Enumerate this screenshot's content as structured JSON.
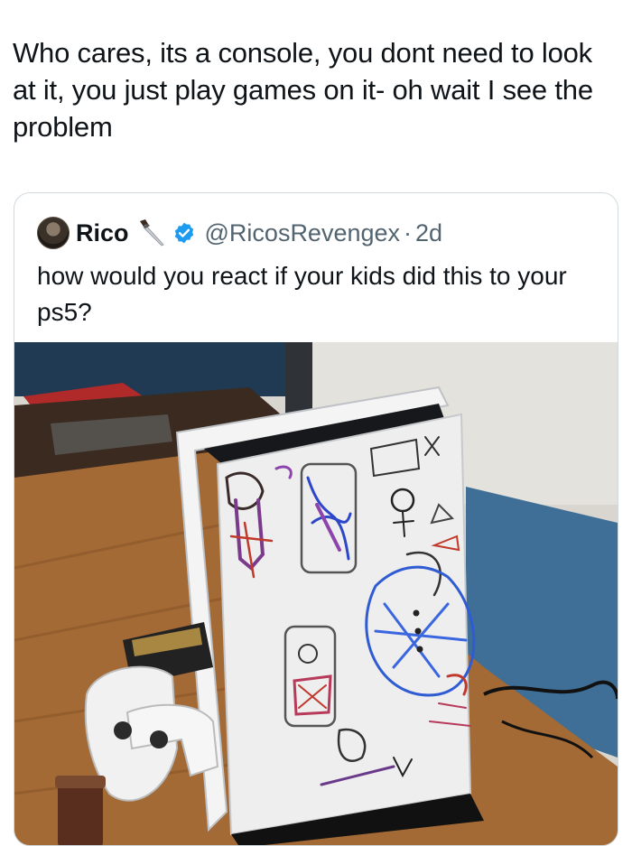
{
  "post": {
    "text": "Who cares, its a console, you dont need to look at it, you just play games on it- oh wait I see the problem"
  },
  "quoted_tweet": {
    "display_name": "Rico",
    "handle": "@RicosRevengex",
    "separator": "·",
    "time": "2d",
    "text": "how would you react if your kids did this to your ps5?",
    "verified_color": "#1d9bf0"
  },
  "icons": {
    "avatar": "avatar",
    "emoji": "knife-icon",
    "verified": "verified-badge-icon"
  },
  "colors": {
    "text": "#0f1419",
    "secondary_text": "#536471",
    "border": "#cfd9de"
  }
}
